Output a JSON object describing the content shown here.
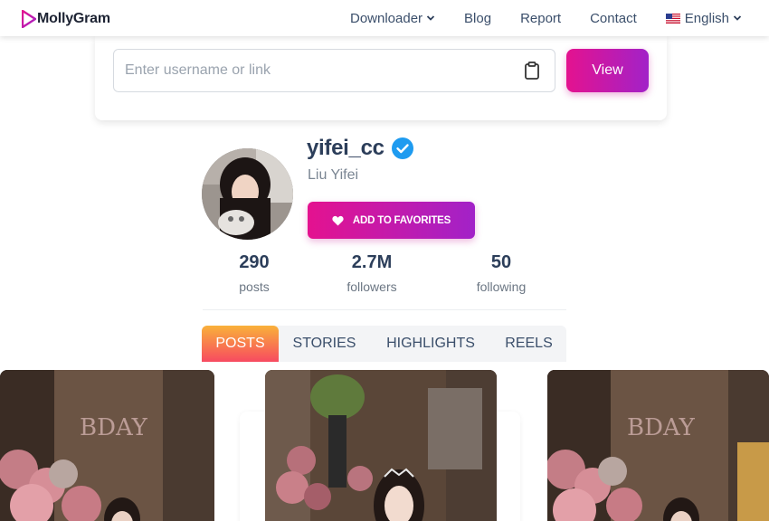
{
  "nav": {
    "logo_text": "MollyGram",
    "links": [
      {
        "label": "Downloader",
        "has_dropdown": true
      },
      {
        "label": "Blog"
      },
      {
        "label": "Report"
      },
      {
        "label": "Contact"
      },
      {
        "label": "English",
        "has_dropdown": true,
        "icon": "us-flag-icon"
      }
    ]
  },
  "search": {
    "placeholder": "Enter username or link",
    "value": "",
    "button_label": "View",
    "paste_icon": "clipboard-icon"
  },
  "profile": {
    "username": "yifei_cc",
    "verified": true,
    "full_name": "Liu Yifei",
    "favorite_button_label": "ADD TO FAVORITES",
    "stats": [
      {
        "value": "290",
        "label": "posts"
      },
      {
        "value": "2.7M",
        "label": "followers"
      },
      {
        "value": "50",
        "label": "following"
      }
    ]
  },
  "tabs": [
    {
      "label": "POSTS",
      "active": true
    },
    {
      "label": "STORIES",
      "active": false
    },
    {
      "label": "HIGHLIGHTS",
      "active": false
    },
    {
      "label": "REELS",
      "active": false
    }
  ],
  "colors": {
    "brand_gradient_start": "#e4128f",
    "brand_gradient_end": "#a222c8",
    "tab_active_start": "#f9b13a",
    "tab_active_end": "#f74a60",
    "verified_blue": "#1e9bf0"
  }
}
